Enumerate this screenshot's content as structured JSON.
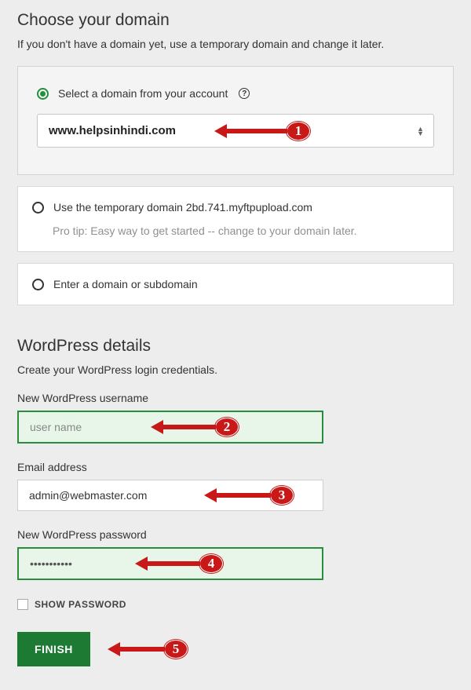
{
  "section1": {
    "title": "Choose your domain",
    "desc": "If you don't have a domain yet, use a temporary domain and change it later."
  },
  "domain_options": {
    "opt1": {
      "label": "Select a domain from your account",
      "selected_value": "www.helpsinhindi.com"
    },
    "opt2": {
      "label": "Use the temporary domain 2bd.741.myftpupload.com",
      "protip": "Pro tip: Easy way to get started -- change to your domain later."
    },
    "opt3": {
      "label": "Enter a domain or subdomain"
    }
  },
  "section2": {
    "title": "WordPress details",
    "desc": "Create your WordPress login credentials."
  },
  "fields": {
    "username_label": "New WordPress username",
    "username_value": "user name",
    "email_label": "Email address",
    "email_value": "admin@webmaster.com",
    "password_label": "New WordPress password",
    "password_value": "•••••••••••"
  },
  "show_password_label": "SHOW PASSWORD",
  "finish_label": "FINISH",
  "annotations": {
    "a1": "1",
    "a2": "2",
    "a3": "3",
    "a4": "4",
    "a5": "5"
  }
}
